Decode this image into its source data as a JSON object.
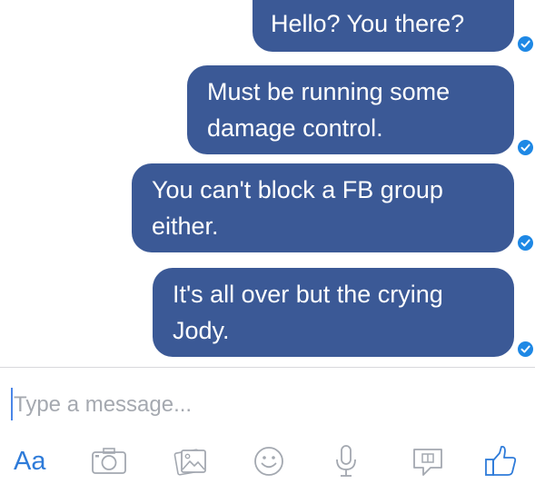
{
  "messages": [
    {
      "text": "Hello? You there?",
      "status": "check-icon"
    },
    {
      "text": "Must be running some\ndamage control.",
      "status": "check-icon"
    },
    {
      "text": "You can't block a FB group\neither.",
      "status": "check-icon"
    },
    {
      "text": "It's all over but the crying\nJody.",
      "status": "check-icon"
    }
  ],
  "composer": {
    "placeholder": "Type a message...",
    "text_style_label": "Aa"
  },
  "toolbar": {
    "icons": [
      "camera-icon",
      "gallery-icon",
      "emoji-icon",
      "microphone-icon",
      "sticker-icon",
      "like-icon"
    ]
  },
  "colors": {
    "bubble": "#3b5996",
    "accent": "#2e7bd9",
    "icon": "#a3a8b0"
  }
}
